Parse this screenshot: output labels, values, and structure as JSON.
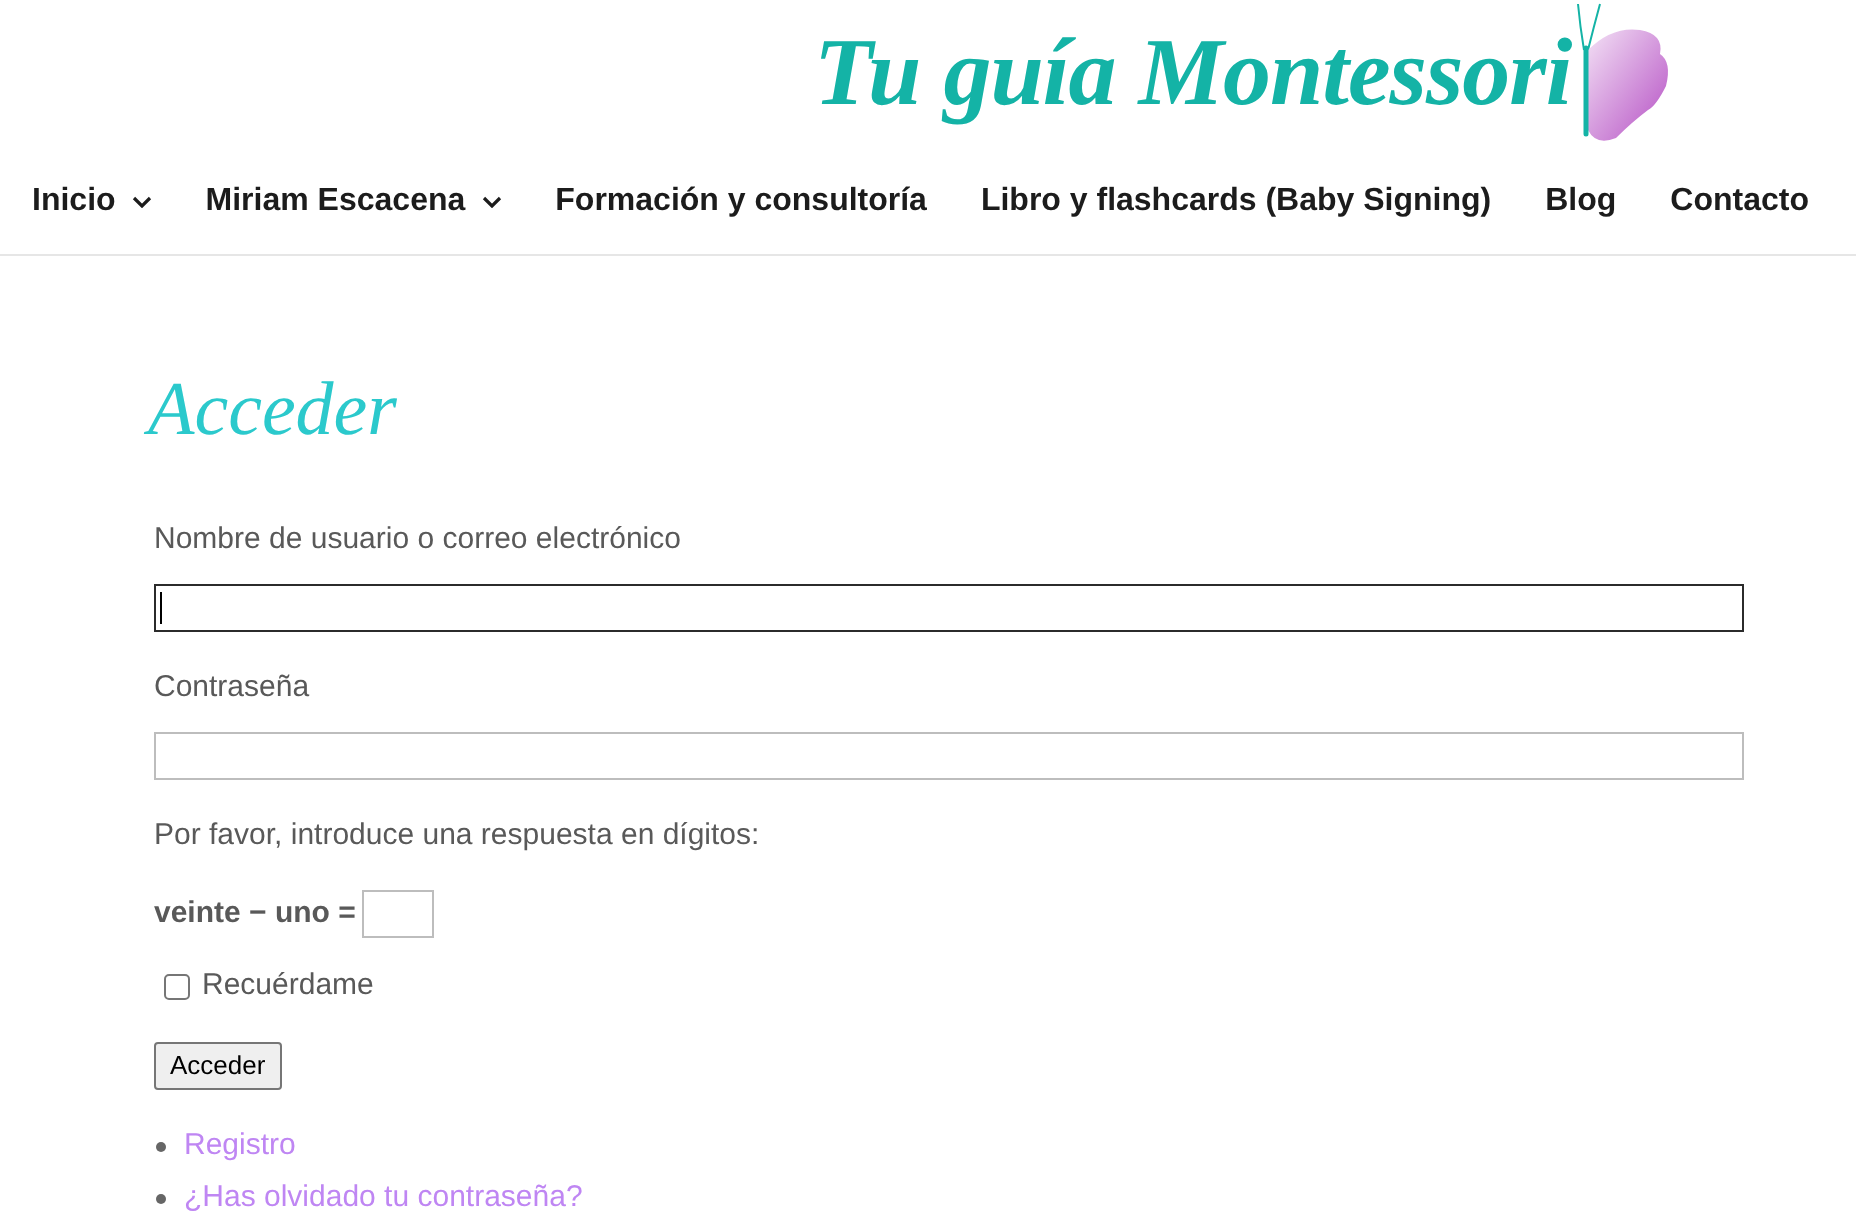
{
  "header": {
    "logo": {
      "text": "Tu guía Montessori"
    }
  },
  "nav": {
    "items": [
      {
        "label": "Inicio",
        "has_submenu": true
      },
      {
        "label": "Miriam Escacena",
        "has_submenu": true
      },
      {
        "label": "Formación y consultoría",
        "has_submenu": false
      },
      {
        "label": "Libro y flashcards (Baby Signing)",
        "has_submenu": false
      },
      {
        "label": "Blog",
        "has_submenu": false
      },
      {
        "label": "Contacto",
        "has_submenu": false
      }
    ]
  },
  "login": {
    "title": "Acceder",
    "fields": [
      {
        "label": "Nombre de usuario o correo electrónico",
        "focused": true
      },
      {
        "label": "Contraseña",
        "focused": false
      }
    ],
    "captcha": {
      "instruction": "Por favor, introduce una respuesta en dígitos:",
      "question": "veinte − uno ="
    },
    "remember": {
      "label": "Recuérdame",
      "checked": false
    },
    "submit": "Acceder",
    "links": [
      "Registro",
      "¿Has olvidado tu contraseña?"
    ]
  }
}
